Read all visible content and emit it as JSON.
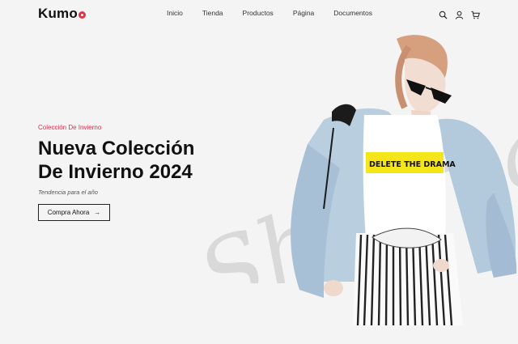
{
  "brand": {
    "name": "Kumo"
  },
  "nav": {
    "items": [
      {
        "label": "Inicio"
      },
      {
        "label": "Tienda"
      },
      {
        "label": "Productos"
      },
      {
        "label": "Página"
      },
      {
        "label": "Documentos"
      }
    ]
  },
  "header_icons": [
    "search-icon",
    "user-icon",
    "cart-icon"
  ],
  "hero": {
    "eyebrow": "Colección De Invierno",
    "title_line1": "Nueva Colección",
    "title_line2": "De Invierno 2024",
    "subtitle": "Tendencia para el año",
    "cta_label": "Compra Ahora",
    "watermark": "Shopmais",
    "tshirt_print": "DELETE THE DRAMA"
  },
  "colors": {
    "background": "#f4f4f4",
    "accent": "#d8304a",
    "text": "#111111",
    "watermark": "#d9d9d9",
    "tshirt_print_bg": "#f5e61b"
  }
}
